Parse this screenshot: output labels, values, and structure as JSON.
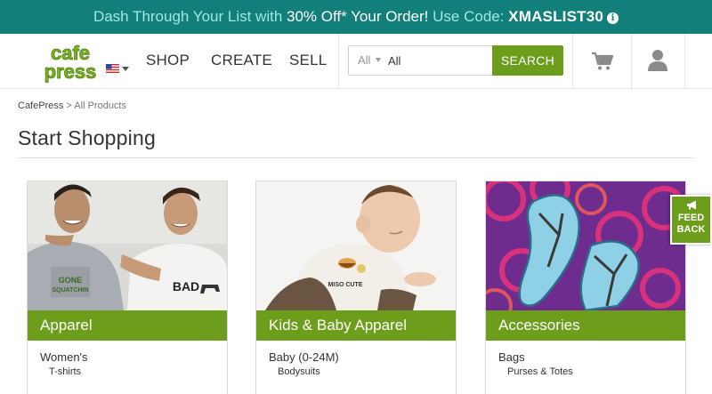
{
  "promo": {
    "part1": "Dash Through Your List with ",
    "part2": "30% Off* Your Order!",
    "part3": " Use Code: ",
    "code": "XMASLIST30",
    "info_icon": "info-icon"
  },
  "header": {
    "logo_text": [
      "cafe",
      "press"
    ],
    "nav": {
      "shop": "SHOP",
      "create": "CREATE",
      "sell": "SELL"
    },
    "search": {
      "category": "All",
      "value": "All",
      "button": "SEARCH"
    },
    "icons": [
      "flag-icon",
      "cart-icon",
      "user-icon"
    ]
  },
  "breadcrumb": {
    "home": "CafePress",
    "separator": " > ",
    "current": "All Products"
  },
  "page_title": "Start Shopping",
  "cards": [
    {
      "title": "Apparel",
      "sub1": "Women's",
      "sub2": "T-shirts",
      "shirt_text_1": "GONE",
      "shirt_text_2": "SQUATCHIN",
      "shirt_text_3": "BAD"
    },
    {
      "title": "Kids & Baby Apparel",
      "sub1": "Baby (0-24M)",
      "sub2": "Bodysuits",
      "shirt_text": "MISO CUTE"
    },
    {
      "title": "Accessories",
      "sub1": "Bags",
      "sub2": "Purses & Totes"
    }
  ],
  "feedback": {
    "line1": "FEED",
    "line2": "BACK"
  },
  "colors": {
    "promo_bg": "#127f7a",
    "brand_green": "#6c9e1c"
  }
}
